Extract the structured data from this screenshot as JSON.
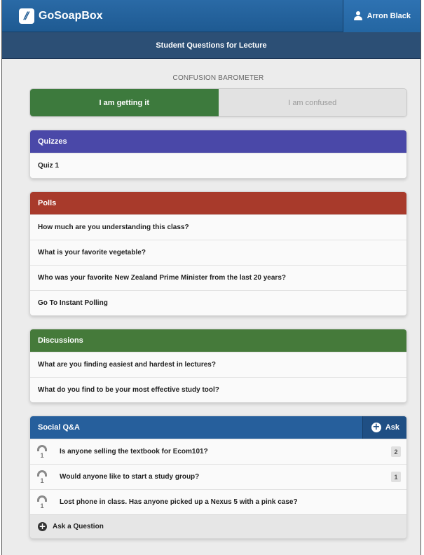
{
  "header": {
    "logo_glyph": "//",
    "brand": "GoSoapBox",
    "user_name": "Arron Black",
    "subtitle": "Student Questions for Lecture"
  },
  "barometer": {
    "title": "CONFUSION BAROMETER",
    "option_getting": "I am getting it",
    "option_confused": "I am confused",
    "selected": "I am getting it"
  },
  "quizzes": {
    "title": "Quizzes",
    "color": "#4a48a8",
    "items": [
      {
        "label": "Quiz 1"
      }
    ]
  },
  "polls": {
    "title": "Polls",
    "color": "#a83a2b",
    "items": [
      {
        "label": "How much are you understanding this class?"
      },
      {
        "label": "What is your favorite vegetable?"
      },
      {
        "label": "Who was your favorite New Zealand Prime Minister from the last 20 years?"
      },
      {
        "label": "Go To Instant Polling"
      }
    ]
  },
  "discussions": {
    "title": "Discussions",
    "color": "#457a3a",
    "items": [
      {
        "label": "What are you finding easiest and hardest in lectures?"
      },
      {
        "label": "What do you find to be your most effective study tool?"
      }
    ]
  },
  "social": {
    "title": "Social Q&A",
    "color": "#265f9c",
    "ask_label": "Ask",
    "ask_icon": "plus-circle-icon",
    "questions": [
      {
        "votes": "1",
        "text": "Is anyone selling the textbook for Ecom101?",
        "count": "2"
      },
      {
        "votes": "1",
        "text": "Would anyone like to start a study group?",
        "count": "1"
      },
      {
        "votes": "1",
        "text": "Lost phone in class. Has anyone picked up a Nexus 5 with a pink case?",
        "count": ""
      }
    ],
    "ask_question_label": "Ask a Question"
  }
}
